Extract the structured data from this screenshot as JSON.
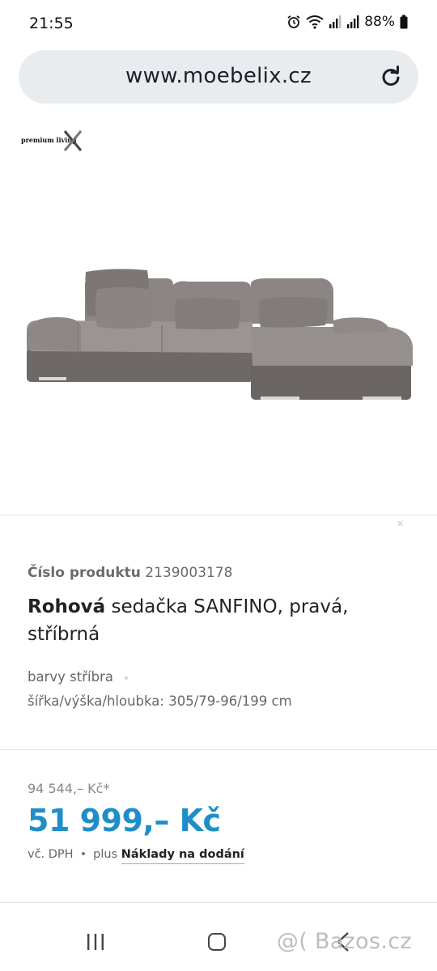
{
  "status_bar": {
    "time": "21:55",
    "battery": "88%",
    "icons": [
      "alarm-icon",
      "wifi-icon",
      "signal-icon",
      "signal-icon",
      "battery-icon"
    ]
  },
  "browser": {
    "url": "www.moebelix.cz",
    "reload_icon": "reload-icon"
  },
  "brand": {
    "logo_text": "premium living"
  },
  "product": {
    "number_label": "Číslo produktu",
    "number": "2139003178",
    "title_bold": "Rohová",
    "title_rest": "sedačka SANFINO, pravá, stříbrná",
    "color_attr": "barvy stříbra",
    "dimensions_attr": "šířka/výška/hloubka: 305/79-96/199 cm"
  },
  "pricing": {
    "old_price": "94 544,– Kč*",
    "price": "51 999,– Kč",
    "vat_note": "vč. DPH",
    "bullet": "•",
    "plus": "plus",
    "shipping_link": "Náklady na dodání",
    "price_color": "#1e8ec9"
  },
  "watermark": "@( Bazos.cz",
  "nav": {
    "recent_icon": "recent-apps-icon",
    "home_icon": "home-icon",
    "back_icon": "back-icon"
  }
}
